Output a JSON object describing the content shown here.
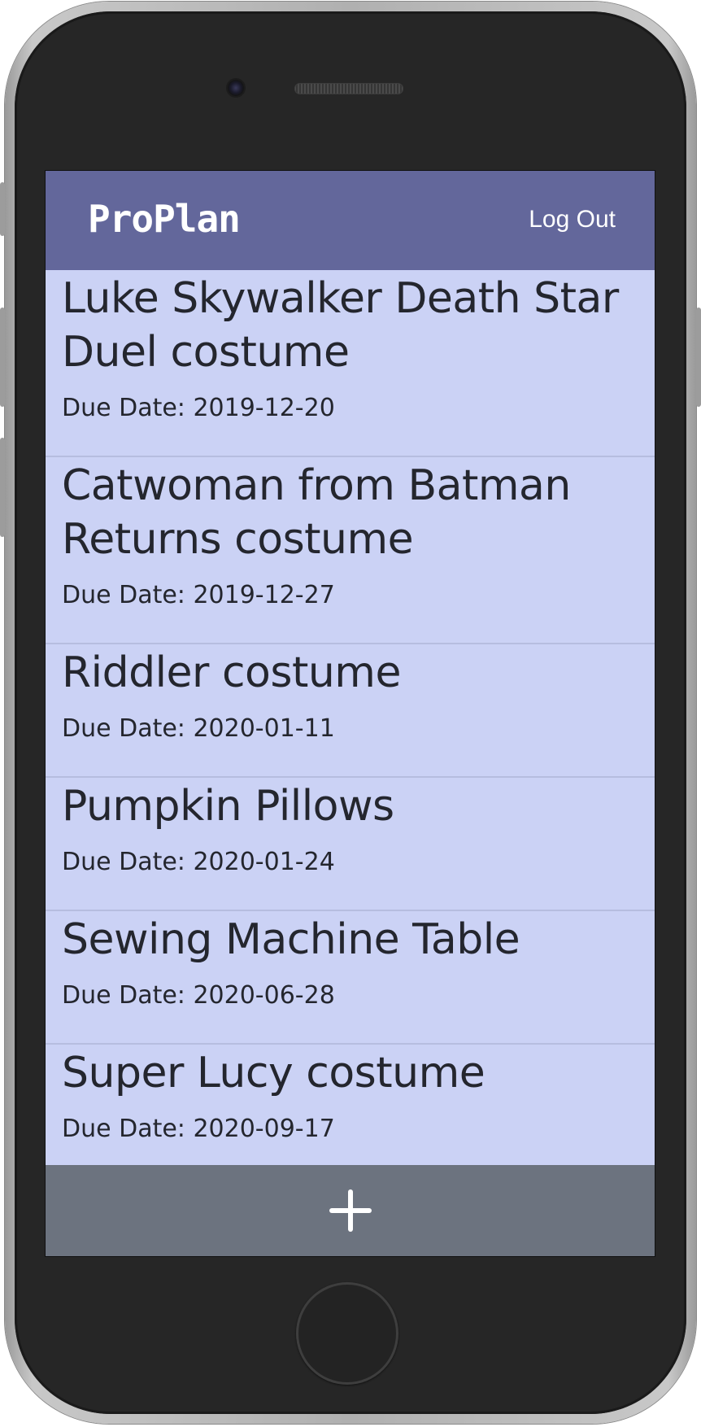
{
  "header": {
    "brand": "ProPlan",
    "logout_label": "Log Out"
  },
  "projects": [
    {
      "title": "Luke Skywalker Death Star Duel costume",
      "due": "Due Date: 2019-12-20"
    },
    {
      "title": "Catwoman from Batman Returns costume",
      "due": "Due Date: 2019-12-27"
    },
    {
      "title": "Riddler costume",
      "due": "Due Date: 2020-01-11"
    },
    {
      "title": "Pumpkin Pillows",
      "due": "Due Date: 2020-01-24"
    },
    {
      "title": "Sewing Machine Table",
      "due": "Due Date: 2020-06-28"
    },
    {
      "title": "Super Lucy costume",
      "due": "Due Date: 2020-09-17"
    }
  ],
  "footer": {
    "add_icon": "plus-icon"
  },
  "colors": {
    "navbar": "#63679b",
    "list_background": "#cbd2f5",
    "footer": "#6c737f",
    "text": "#24262e"
  }
}
